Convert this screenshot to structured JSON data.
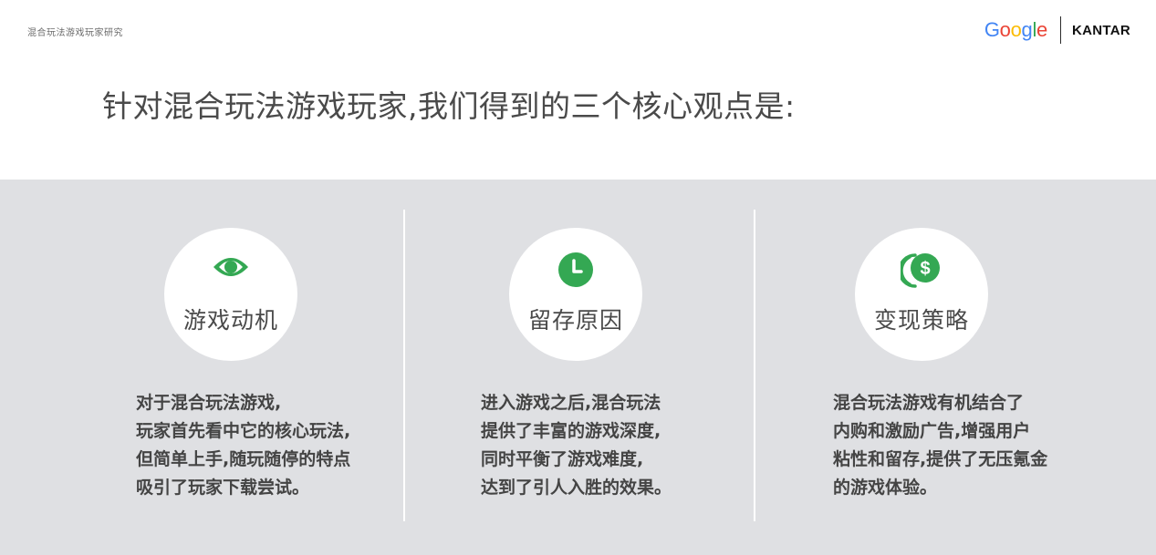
{
  "header": {
    "label": "混合玩法游戏玩家研究",
    "google_letters": [
      "G",
      "o",
      "o",
      "g",
      "l",
      "e"
    ],
    "kantar": "KANTAR"
  },
  "headline": "针对混合玩法游戏玩家,我们得到的三个核心观点是:",
  "colors": {
    "accent_green": "#34a853",
    "panel_bg": "#dfe0e3",
    "google_blue": "#4285F4",
    "google_red": "#EA4335",
    "google_yellow": "#FBBC05",
    "google_green": "#34A853"
  },
  "insights": [
    {
      "icon": "eye-icon",
      "title": "游戏动机",
      "lines": [
        "对于混合玩法游戏,",
        "玩家首先看中它的核心玩法,",
        "但简单上手,随玩随停的特点",
        "吸引了玩家下载尝试。"
      ]
    },
    {
      "icon": "clock-icon",
      "title": "留存原因",
      "lines": [
        "进入游戏之后,混合玩法",
        "提供了丰富的游戏深度,",
        "同时平衡了游戏难度,",
        "达到了引人入胜的效果。"
      ]
    },
    {
      "icon": "dollar-coins-icon",
      "title": "变现策略",
      "lines": [
        "混合玩法游戏有机结合了",
        "内购和激励广告,增强用户",
        "粘性和留存,提供了无压氪金",
        "的游戏体验。"
      ]
    }
  ]
}
